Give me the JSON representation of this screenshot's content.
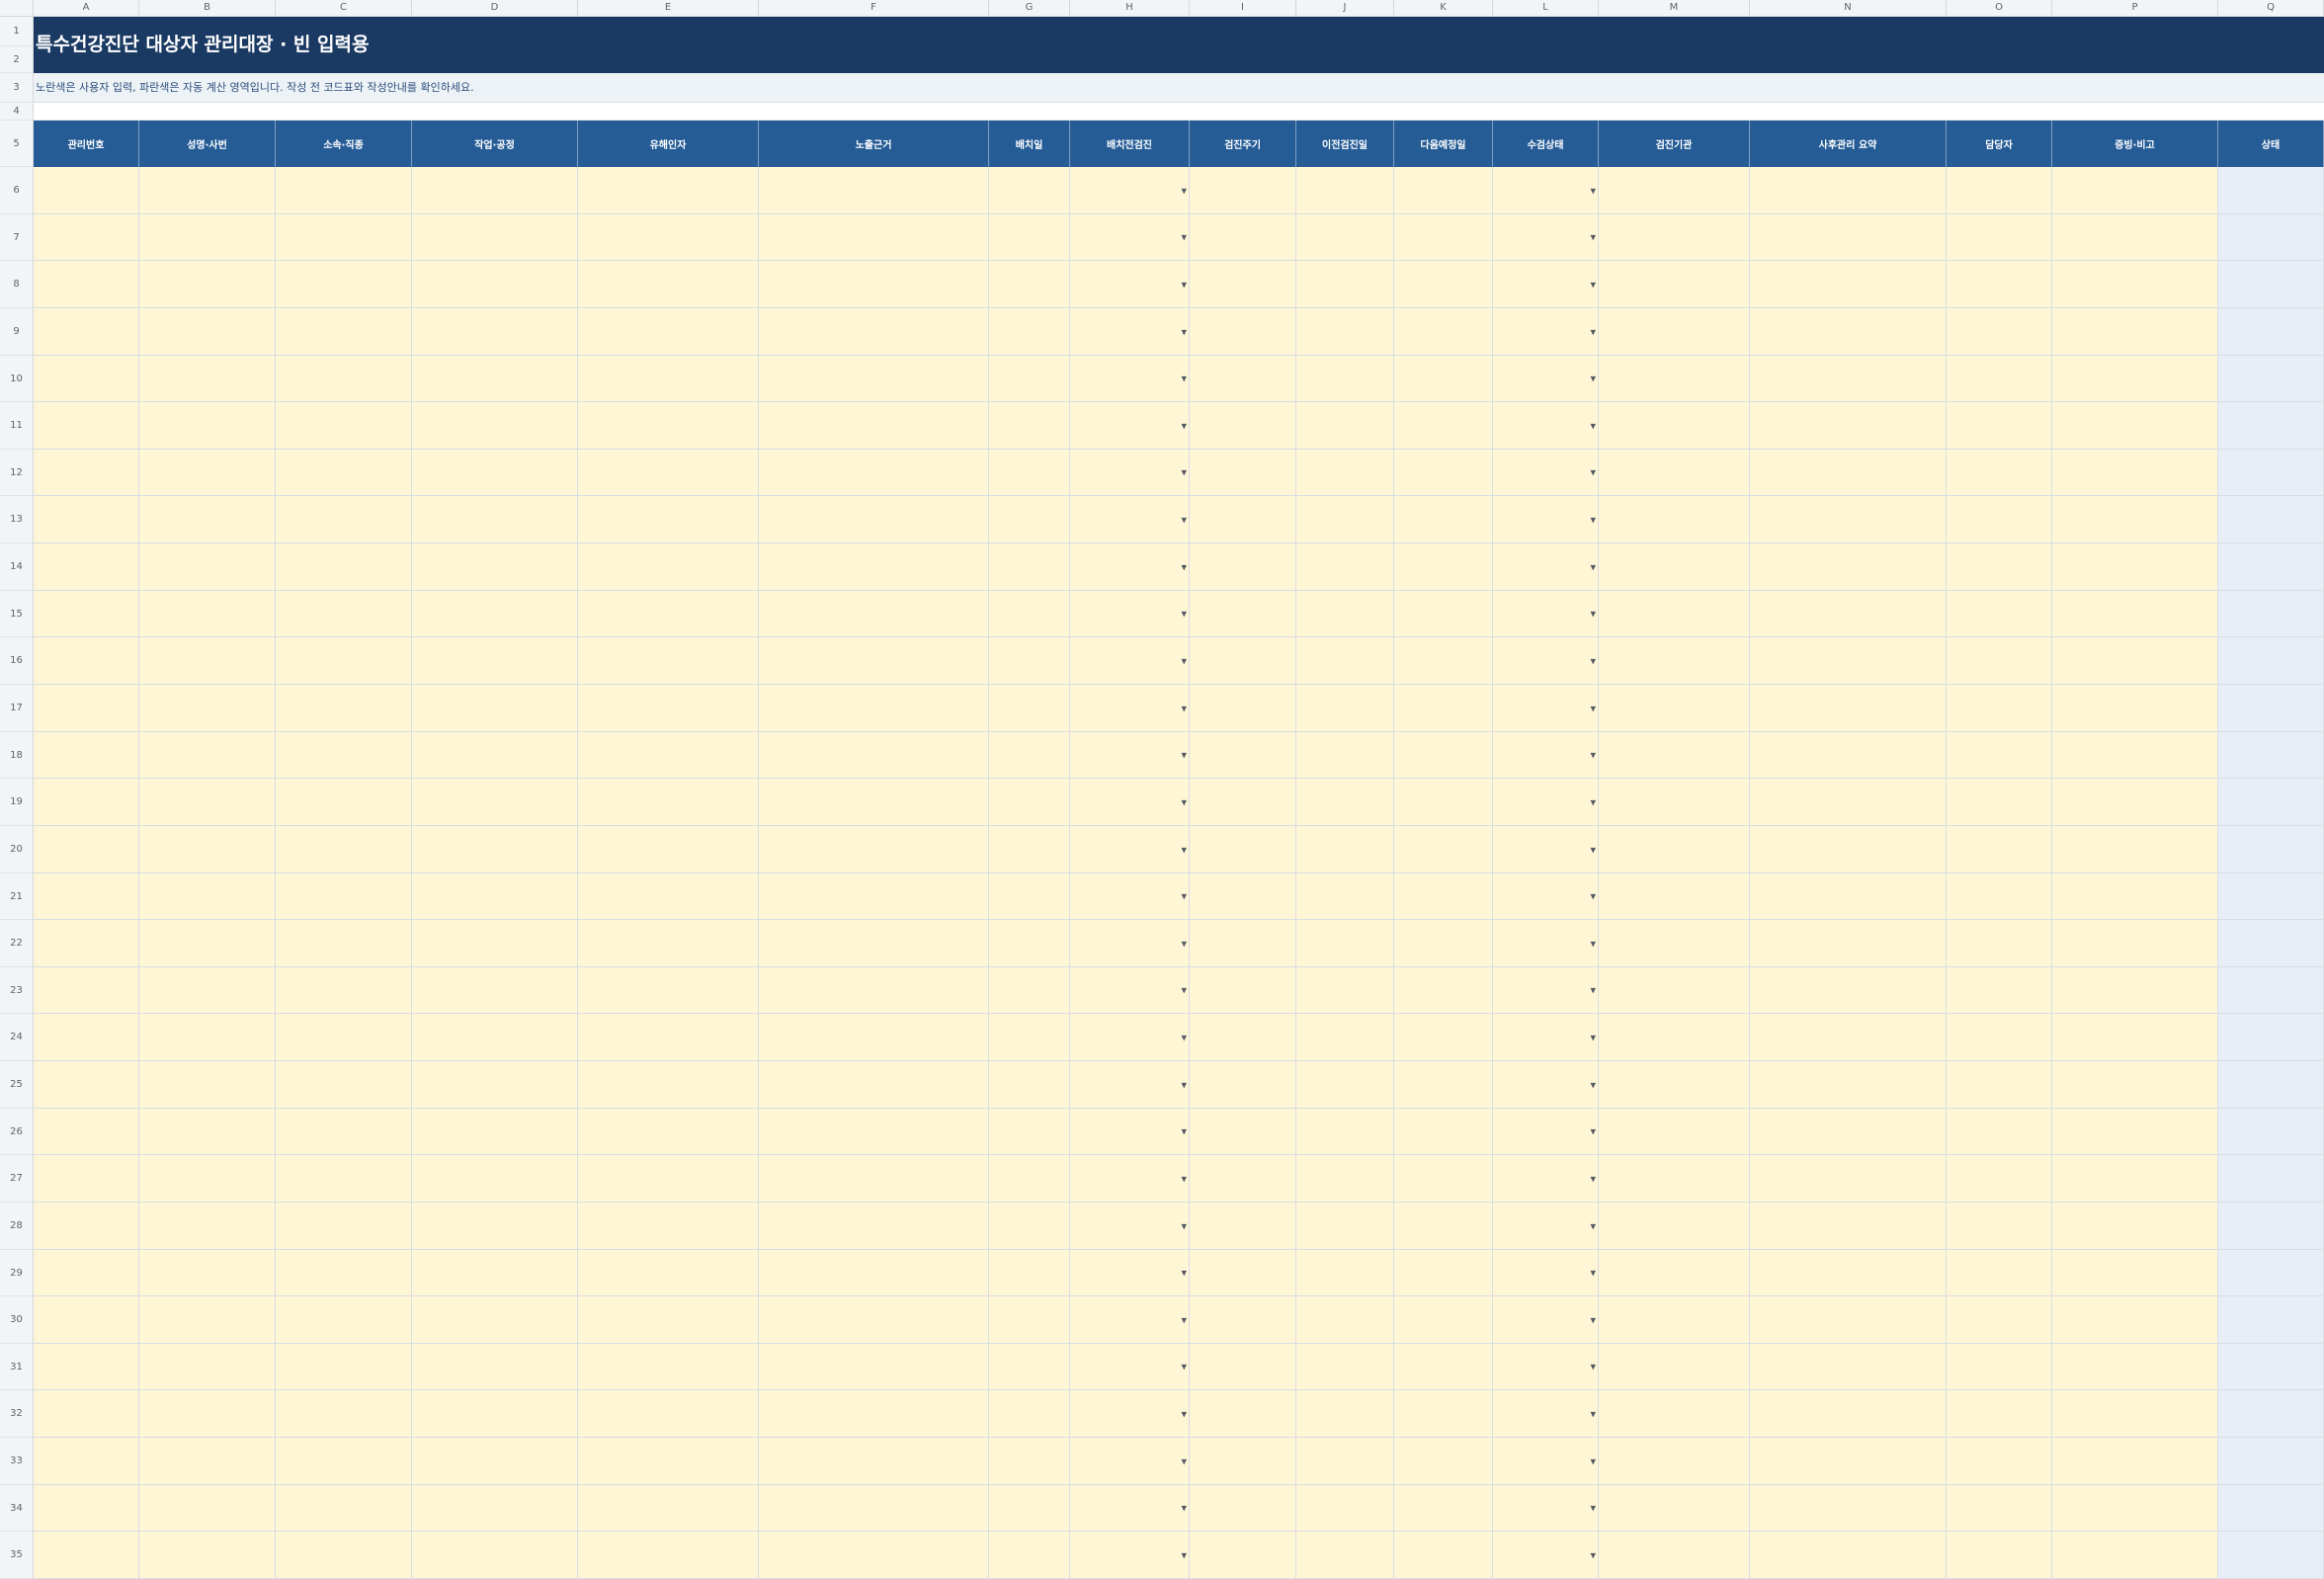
{
  "sheet": {
    "title": "특수건강진단 대상자 관리대장 · 빈 입력용",
    "note": "노란색은 사용자 입력, 파란색은 자동 계산 영역입니다. 작성 전 코드표와 작성안내를 확인하세요.",
    "column_letters": [
      "A",
      "B",
      "C",
      "D",
      "E",
      "F",
      "G",
      "H",
      "I",
      "J",
      "K",
      "L",
      "M",
      "N",
      "O",
      "P",
      "Q"
    ],
    "headers": [
      "관리번호",
      "성명·사번",
      "소속·직종",
      "작업·공정",
      "유해인자",
      "노출근거",
      "배치일",
      "배치전검진",
      "검진주기",
      "이전검진일",
      "다음예정일",
      "수검상태",
      "검진기관",
      "사후관리 요약",
      "담당자",
      "증빙·비고",
      "상태"
    ],
    "header_row_number": "5",
    "top_row_numbers": [
      "1",
      "2",
      "3",
      "4"
    ],
    "first_data_row": 6,
    "last_data_row": 35,
    "dropdown_columns": [
      "H",
      "L"
    ],
    "auto_columns": [
      "Q"
    ]
  },
  "colors": {
    "title_band": "#1a3a63",
    "header_band": "#255c96",
    "input_cell": "#fff6d6",
    "auto_cell": "#e7eef7",
    "note_band": "#edf2f7"
  }
}
